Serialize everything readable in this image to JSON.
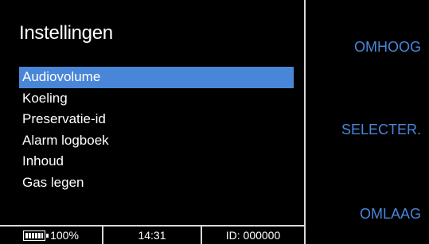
{
  "title": "Instellingen",
  "menu": {
    "items": [
      {
        "label": "Audiovolume",
        "selected": true
      },
      {
        "label": "Koeling",
        "selected": false
      },
      {
        "label": "Preservatie-id",
        "selected": false
      },
      {
        "label": "Alarm logboek",
        "selected": false
      },
      {
        "label": "Inhoud",
        "selected": false
      },
      {
        "label": "Gas legen",
        "selected": false
      }
    ]
  },
  "status": {
    "battery_percent": "100%",
    "battery_level": 1.0,
    "time": "14:31",
    "id": "ID: 000000"
  },
  "softkeys": {
    "up": "OMHOOG",
    "select": "SELECTER.",
    "down": "OMLAAG"
  },
  "colors": {
    "accent": "#4a86d8",
    "background": "#000000",
    "text": "#ffffff",
    "divider": "#d8d8d8"
  },
  "icons": {
    "battery": "battery-icon"
  }
}
